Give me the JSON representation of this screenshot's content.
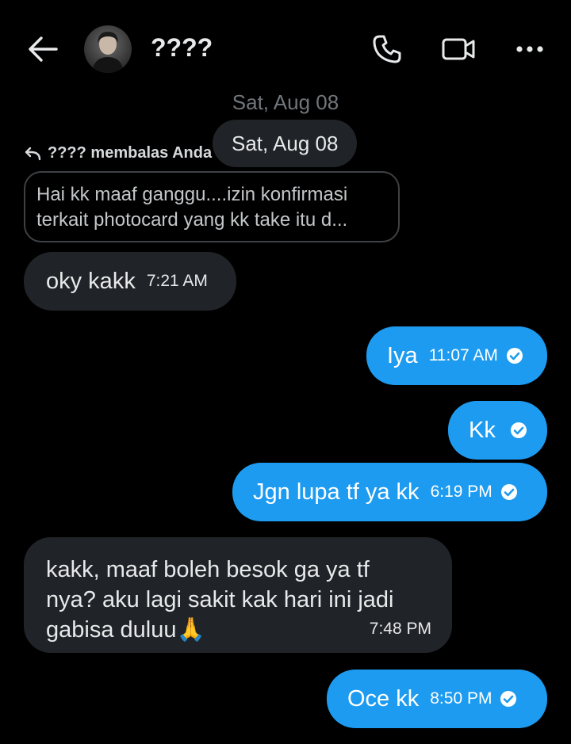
{
  "header": {
    "title": "????",
    "back_icon": "arrow-left-icon",
    "call_icon": "phone-icon",
    "video_icon": "video-camera-icon",
    "more_icon": "more-dots-icon"
  },
  "dates": {
    "ghost": "Sat, Aug 08",
    "pill": "Sat, Aug 08"
  },
  "reply": {
    "label": "???? membalas Anda",
    "quoted_line1": "Hai kk maaf ganggu....izin konfirmasi",
    "quoted_line2": "terkait photocard yang kk take itu d..."
  },
  "messages": [
    {
      "direction": "incoming",
      "text": "oky kakk",
      "time": "7:21 AM"
    },
    {
      "direction": "outgoing",
      "text": "Iya",
      "time": "11:07 AM",
      "seen": true
    },
    {
      "direction": "outgoing",
      "text": "Kk",
      "time": "",
      "seen": true
    },
    {
      "direction": "outgoing",
      "text": "Jgn lupa tf ya kk",
      "time": "6:19 PM",
      "seen": true
    },
    {
      "direction": "incoming",
      "lines": [
        "kakk, maaf boleh besok ga ya tf",
        "nya? aku lagi sakit kak hari ini jadi",
        "gabisa duluu🙏"
      ],
      "time": "7:48 PM"
    },
    {
      "direction": "outgoing",
      "text": "Oce kk",
      "time": "8:50 PM",
      "seen": true
    }
  ],
  "colors": {
    "background": "#000000",
    "outgoing_bubble": "#1d9bf0",
    "incoming_bubble": "#202327",
    "text": "#e7e9ea"
  }
}
